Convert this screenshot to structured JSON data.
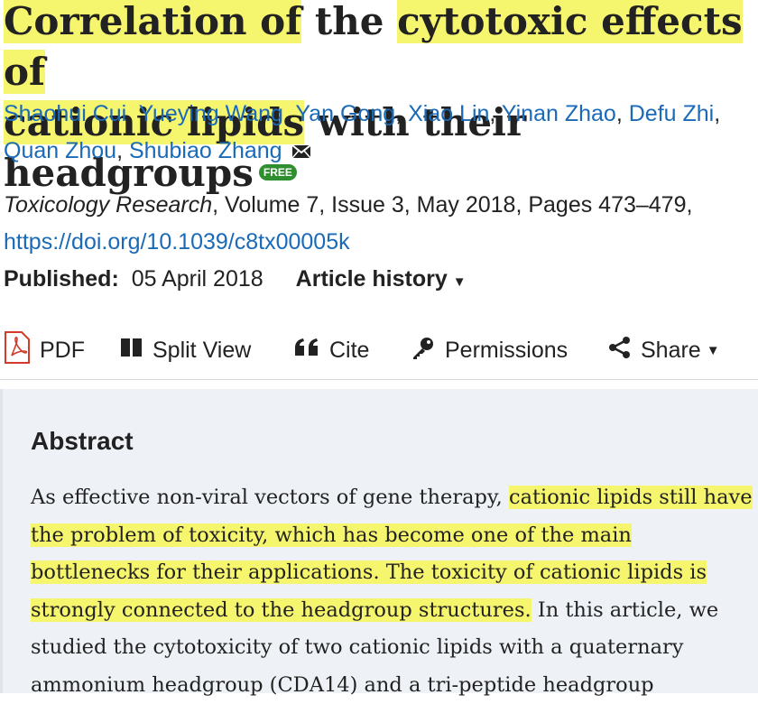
{
  "article": {
    "title_parts": [
      {
        "text": "Correlation of",
        "highlight": true
      },
      {
        "text": " the ",
        "highlight": false
      },
      {
        "text": "cytotoxic effects of",
        "highlight": true
      },
      {
        "text": " ",
        "highlight": false
      },
      {
        "text": "cationic lipids",
        "highlight": true
      },
      {
        "text": " with their headgroups",
        "highlight": false
      }
    ],
    "badge": "FREE",
    "authors": [
      "Shaohui Cui",
      "Yueying Wang",
      "Yan Gong",
      "Xiao Lin",
      "Yinan Zhao",
      "Defu Zhi",
      "Quan Zhou",
      "Shubiao Zhang"
    ],
    "journal": "Toxicology Research",
    "citation_rest": ", Volume 7, Issue 3, May 2018, Pages 473–479,",
    "doi": "https://doi.org/10.1039/c8tx00005k",
    "published_label": "Published:",
    "published_date": "05 April 2018",
    "history_label": "Article history"
  },
  "toolbar": {
    "pdf": "PDF",
    "split_view": "Split View",
    "cite": "Cite",
    "permissions": "Permissions",
    "share": "Share"
  },
  "abstract": {
    "heading": "Abstract",
    "text_parts": [
      {
        "text": "As effective non-viral vectors of gene therapy, ",
        "highlight": false
      },
      {
        "text": "cationic lipids still have the problem of toxicity, which has become one of the main bottlenecks for their applications. The toxicity of cationic lipids is strongly connected to the headgroup structures.",
        "highlight": true
      },
      {
        "text": " In this article, we studied the cytotoxicity of two cationic lipids with a quaternary ammonium headgroup (CDA14) and a tri-peptide headgroup",
        "highlight": false
      }
    ]
  },
  "colors": {
    "highlight": "#f6f66e",
    "link": "#1a6ab8",
    "free_badge": "#2f8f2f",
    "pdf_icon": "#d23b2b",
    "abstract_bg": "#eef2f7"
  },
  "icons": [
    "pdf-icon",
    "split-view-icon",
    "quote-icon",
    "key-icon",
    "share-icon",
    "envelope-icon",
    "caret-down-icon"
  ]
}
